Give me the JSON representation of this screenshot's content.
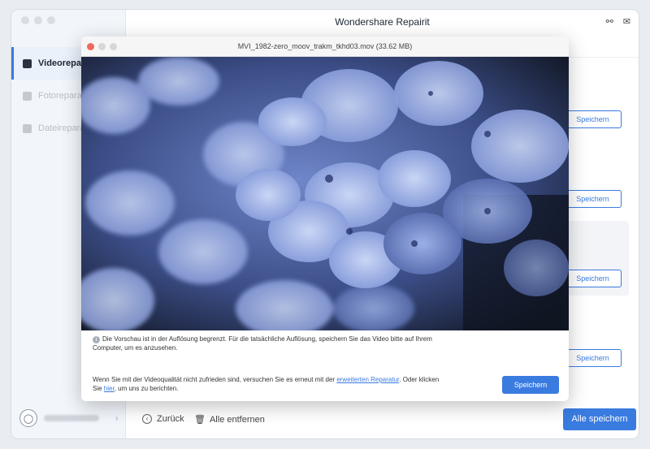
{
  "app": {
    "title": "Wondershare Repairit"
  },
  "sidebar": {
    "items": [
      {
        "label": "Videoreparatur",
        "active": true
      },
      {
        "label": "Fotoreparatur",
        "active": false
      },
      {
        "label": "Dateireparatur",
        "active": false
      }
    ]
  },
  "main": {
    "save_buttons": [
      "Speichern",
      "Speichern",
      "Speichern",
      "Speichern"
    ]
  },
  "bottom_bar": {
    "back_label": "Zurück",
    "remove_label": "Alle entfernen",
    "save_all_label": "Alle speichern"
  },
  "dialog": {
    "title": "MVI_1982-zero_moov_trakm_tkhd03.mov (33.62 MB)",
    "note": "Die Vorschau ist in der Auflösung begrenzt. Für die tatsächliche Auflösung, speichern Sie das Video bitte auf Ihrem Computer, um es anzusehen.",
    "quality_pre": "Wenn Sie mit der Videoqualität nicht zufrieden sind, versuchen Sie es erneut mit der ",
    "quality_link1": "erweiterten Reparatur",
    "quality_mid": ". Oder klicken Sie ",
    "quality_link2": "hier",
    "quality_post": ", um uns zu berichten.",
    "save_label": "Speichern"
  },
  "colors": {
    "accent": "#3a7be0",
    "sidebar_bg": "#f2f6fb",
    "close": "#ed6a5e",
    "minimize": "#d7d7d7",
    "maximize": "#d7d7d7"
  },
  "icons": [
    "video-icon",
    "photo-icon",
    "file-icon",
    "headset-icon",
    "mail-icon",
    "user-icon",
    "chevron-right-icon",
    "back-icon",
    "trash-icon",
    "info-icon"
  ]
}
